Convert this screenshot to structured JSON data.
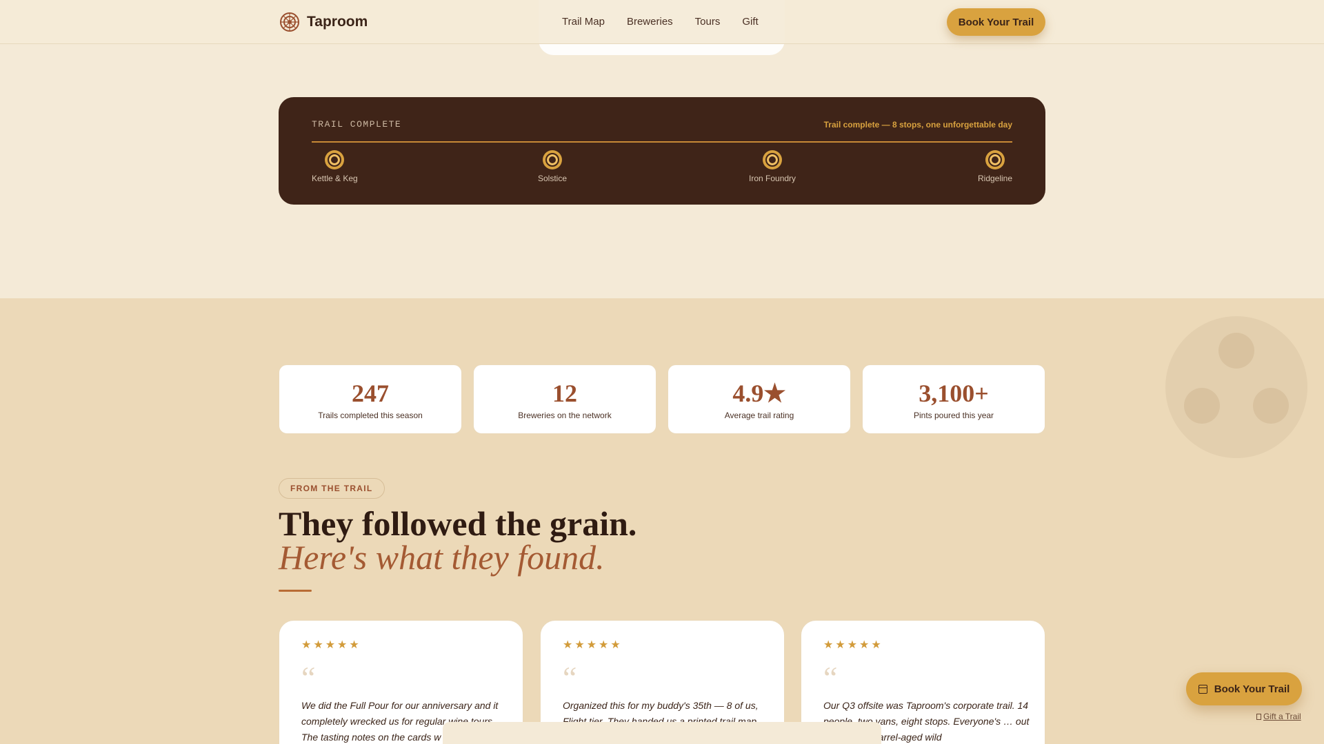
{
  "brand": {
    "name": "Taproom",
    "accent": "#d9a23f",
    "dark": "#3f2418",
    "rust": "#9a4f2e"
  },
  "nav": {
    "links": [
      "Trail Map",
      "Breweries",
      "Tours",
      "Gift"
    ],
    "cta": "Book Your Trail"
  },
  "trail": {
    "kicker": "TRAIL COMPLETE",
    "status": "Trail complete — 8 stops, one unforgettable day",
    "stops": [
      "Kettle & Keg",
      "Solstice",
      "Iron Foundry",
      "Ridgeline"
    ]
  },
  "stats": [
    {
      "value": "247",
      "label": "Trails completed this season"
    },
    {
      "value": "12",
      "label": "Breweries on the network"
    },
    {
      "value": "4.9★",
      "label": "Average trail rating"
    },
    {
      "value": "3,100+",
      "label": "Pints poured this year"
    }
  ],
  "section": {
    "eyebrow": "FROM THE TRAIL",
    "headline": "They followed the grain.",
    "headline_em": "Here's what they found."
  },
  "testimonials": [
    {
      "rating": 5,
      "quote": "We did the Full Pour for our anniversary and it completely wrecked us for regular wine tours. The tasting notes on the cards w"
    },
    {
      "rating": 5,
      "quote": "Organized this for my buddy's 35th — 8 of us, Flight tier. They handed us a printed trail map"
    },
    {
      "rating": 5,
      "quote": "Our Q3 offsite was Taproom's corporate trail. 14 people, two vans, eight stops. Everyone's … out Ridgeline's barrel-aged wild"
    }
  ],
  "float_cta": {
    "label": "Book Your Trail",
    "icon": "calendar-icon"
  },
  "gift_link": "Gift a Trail"
}
